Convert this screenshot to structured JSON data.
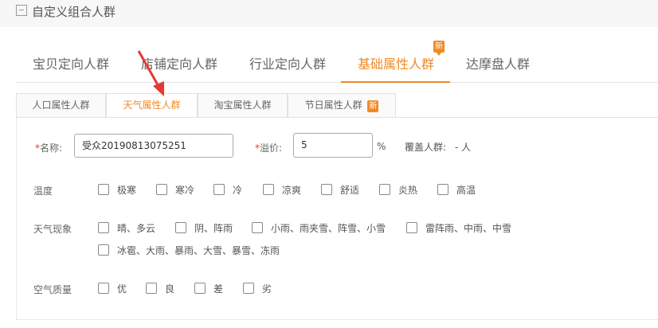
{
  "header": {
    "title": "自定义组合人群",
    "icon": "audience-group-icon"
  },
  "top_tabs": [
    {
      "label": "宝贝定向人群"
    },
    {
      "label": "店铺定向人群"
    },
    {
      "label": "行业定向人群"
    },
    {
      "label": "基础属性人群",
      "active": true,
      "badge": "新"
    },
    {
      "label": "达摩盘人群"
    }
  ],
  "sub_tabs": [
    {
      "label": "人口属性人群"
    },
    {
      "label": "天气属性人群",
      "active": true
    },
    {
      "label": "淘宝属性人群"
    },
    {
      "label": "节日属性人群",
      "badge": "新"
    }
  ],
  "form": {
    "name_label": "名称:",
    "name_value": "受众20190813075251",
    "premium_label": "溢价:",
    "premium_value": "5",
    "premium_unit": "%",
    "coverage_label": "覆盖人群:",
    "coverage_value": "- 人",
    "required_mark": "*"
  },
  "groups": {
    "temperature": {
      "label": "温度",
      "options": [
        "极寒",
        "寒冷",
        "冷",
        "凉爽",
        "舒适",
        "炎热",
        "高温"
      ]
    },
    "weather": {
      "label": "天气现象",
      "options": [
        "晴、多云",
        "阴、阵雨",
        "小雨、雨夹雪、阵雪、小雪",
        "雷阵雨、中雨、中雪",
        "冰雹、大雨、暴雨、大雪、暴雪、冻雨"
      ]
    },
    "air": {
      "label": "空气质量",
      "options": [
        "优",
        "良",
        "差",
        "劣"
      ]
    }
  },
  "colors": {
    "accent": "#f08a24",
    "required": "#e03b2e",
    "annotation_arrow": "#e53935"
  }
}
